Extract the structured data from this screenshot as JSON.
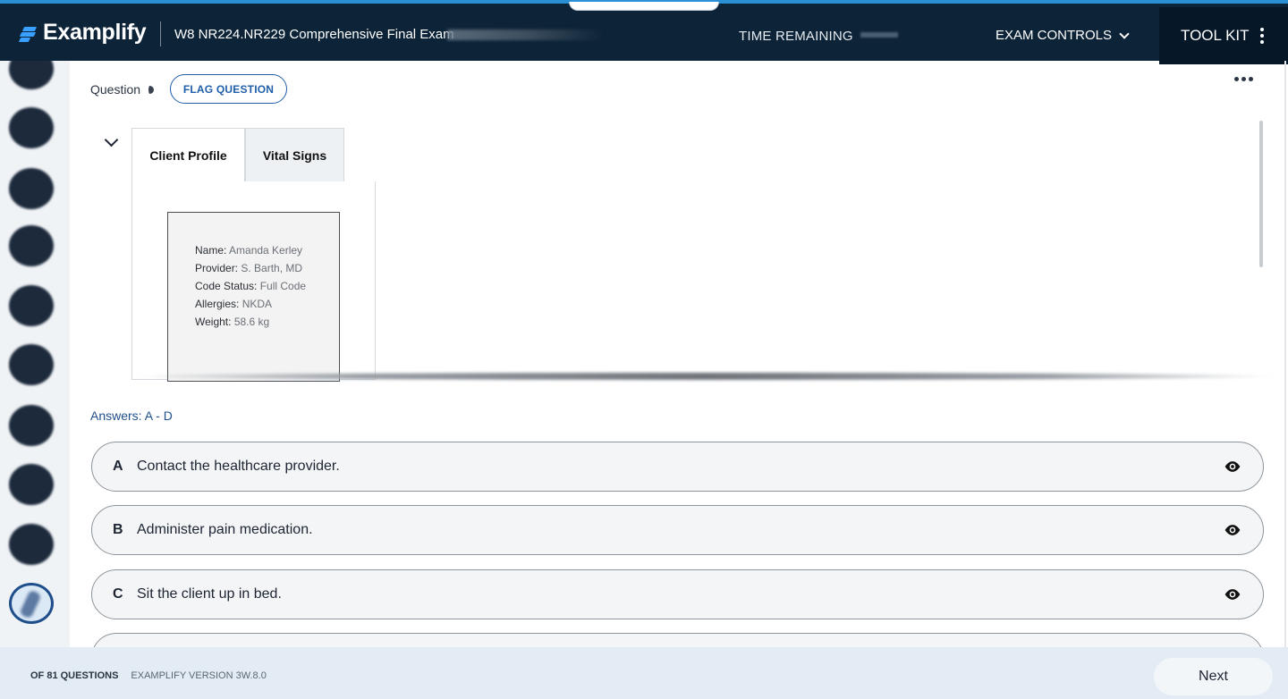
{
  "header": {
    "logo_text": "Examplify",
    "exam_title": "W8 NR224.NR229 Comprehensive Final Exam",
    "time_remaining_label": "TIME REMAINING",
    "exam_controls_label": "EXAM CONTROLS",
    "toolkit_label": "TOOL KIT",
    "accent_color": "#2b8fd6",
    "bar_color": "#0d2337"
  },
  "question": {
    "label": "Question",
    "flag_button": "FLAG QUESTION",
    "more_icon": "ellipsis-icon",
    "tabs": [
      {
        "label": "Client Profile",
        "active": true
      },
      {
        "label": "Vital Signs",
        "active": false
      }
    ],
    "client_profile": [
      {
        "key": "Name:",
        "value": "Amanda Kerley"
      },
      {
        "key": "Provider:",
        "value": "S. Barth, MD"
      },
      {
        "key": "Code Status:",
        "value": "Full Code"
      },
      {
        "key": "Allergies:",
        "value": "NKDA"
      },
      {
        "key": "Weight:",
        "value": "58.6 kg"
      }
    ]
  },
  "answers": {
    "label": "Answers: A - D",
    "options": [
      {
        "letter": "A",
        "text": "Contact the healthcare provider.",
        "icon": "eye-icon"
      },
      {
        "letter": "B",
        "text": "Administer pain medication.",
        "icon": "eye-icon"
      },
      {
        "letter": "C",
        "text": "Sit the client up in bed.",
        "icon": "eye-icon"
      }
    ]
  },
  "footer": {
    "question_count": "OF 81 QUESTIONS",
    "version": "EXAMPLIFY VERSION 3W.8.0",
    "next_label": "Next"
  }
}
